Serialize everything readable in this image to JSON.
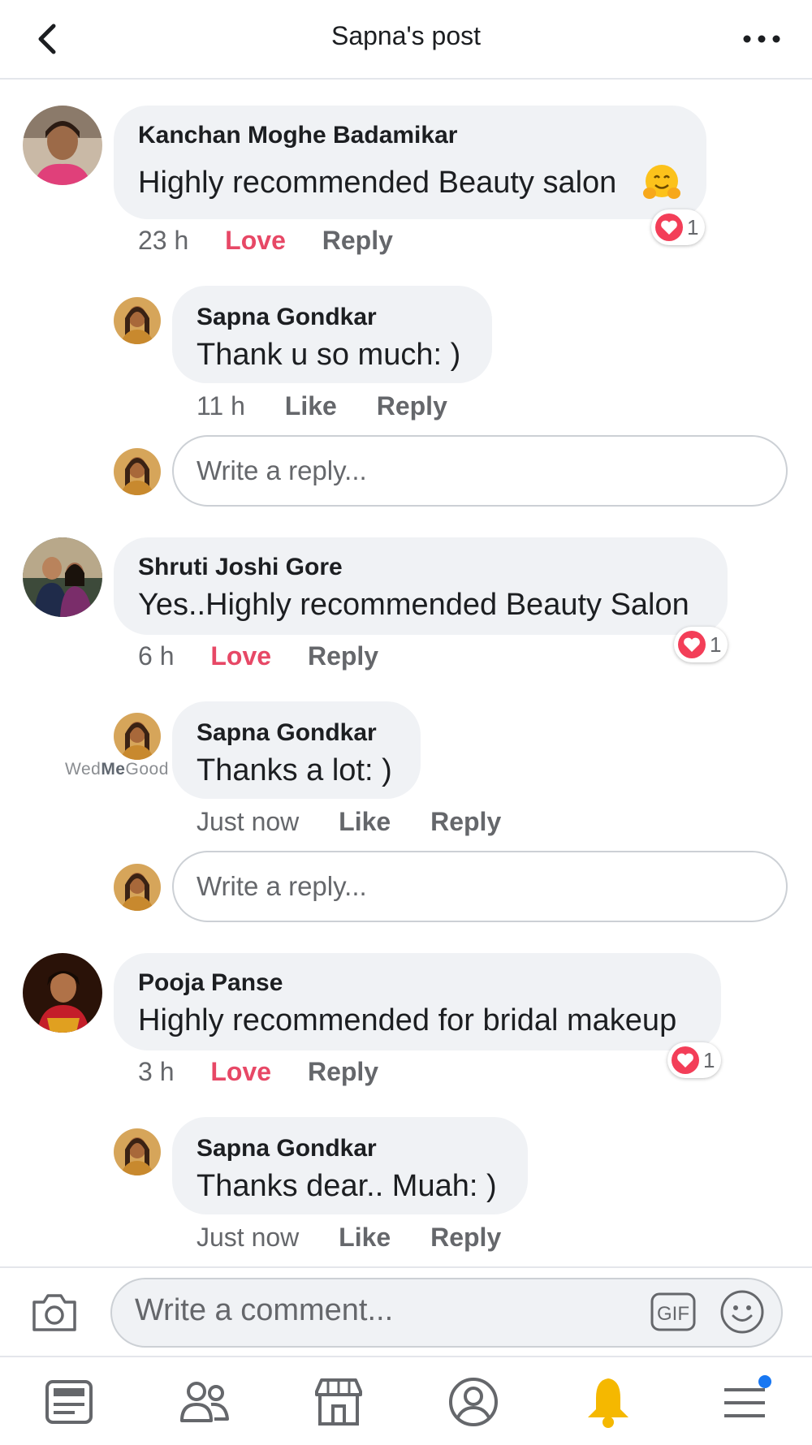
{
  "header": {
    "title": "Sapna's post"
  },
  "watermark": {
    "prefix": "Wed",
    "middle": "Me",
    "suffix": "Good"
  },
  "comments": [
    {
      "author": "Kanchan Moghe Badamikar",
      "text": "Highly recommended Beauty salon",
      "emoji": "hugging-face",
      "time": "23 h",
      "love_label": "Love",
      "reply_label": "Reply",
      "reaction_count": "1",
      "reply": {
        "author": "Sapna Gondkar",
        "text": "Thank u so much: )",
        "time": "11 h",
        "like_label": "Like",
        "reply_label": "Reply"
      },
      "reply_placeholder": "Write a reply..."
    },
    {
      "author": "Shruti Joshi Gore",
      "text": "Yes..Highly recommended Beauty Salon",
      "time": "6 h",
      "love_label": "Love",
      "reply_label": "Reply",
      "reaction_count": "1",
      "reply": {
        "author": "Sapna Gondkar",
        "text": "Thanks a lot: )",
        "time": "Just now",
        "like_label": "Like",
        "reply_label": "Reply"
      },
      "reply_placeholder": "Write a reply..."
    },
    {
      "author": "Pooja Panse",
      "text": "Highly recommended for bridal makeup",
      "time": "3 h",
      "love_label": "Love",
      "reply_label": "Reply",
      "reaction_count": "1",
      "reply": {
        "author": "Sapna Gondkar",
        "text": "Thanks dear.. Muah: )",
        "time": "Just now",
        "like_label": "Like",
        "reply_label": "Reply"
      }
    }
  ],
  "composer": {
    "placeholder": "Write a comment...",
    "gif_label": "GIF"
  },
  "nav": {
    "items": [
      "news-feed-icon",
      "friends-icon",
      "marketplace-icon",
      "profile-icon",
      "notifications-icon",
      "menu-icon"
    ],
    "active": "notifications-icon"
  },
  "colors": {
    "love": "#e74866",
    "notifications": "#f5b800",
    "badge": "#1877f2",
    "bubble": "#f0f2f5"
  }
}
